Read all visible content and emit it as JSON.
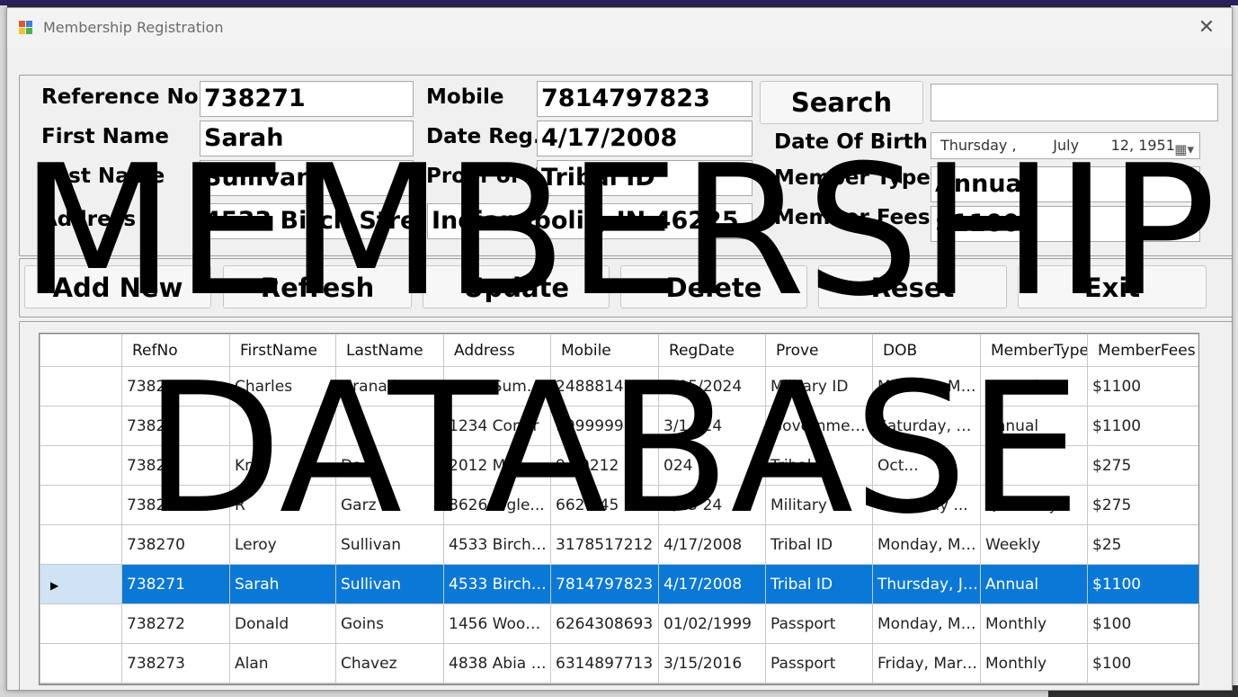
{
  "window": {
    "title": "Membership Registration",
    "close_glyph": "✕"
  },
  "form": {
    "reference_no": {
      "label": "Reference No:",
      "value": "738271"
    },
    "first_name": {
      "label": "First Name",
      "value": "Sarah"
    },
    "last_name": {
      "label": "Last Name",
      "value": "Sullivan"
    },
    "address": {
      "label": "Address",
      "value": "4533 Birch Street",
      "value2": "Indianapolis, IN 46225"
    },
    "mobile": {
      "label": "Mobile",
      "value": "7814797823"
    },
    "date_reg": {
      "label": "Date Reg.",
      "value": "4/17/2008"
    },
    "proof_of_id": {
      "label": "Proof of ID",
      "value": "Tribal ID"
    },
    "search": {
      "label": "Search",
      "value": ""
    },
    "date_of_birth": {
      "label": "Date Of Birth",
      "day": "Thursday",
      "month": "July",
      "date": "12, 1951"
    },
    "member_type": {
      "label": "Member Type",
      "value": "Annual"
    },
    "member_fees": {
      "label": "Member Fees",
      "value": "$1100"
    }
  },
  "buttons": {
    "add_new": "Add New",
    "refresh": "Refresh",
    "update": "Update",
    "delete": "Delete",
    "reset": "Reset",
    "exit": "Exit"
  },
  "grid": {
    "columns": [
      "RefNo",
      "FirstName",
      "LastName",
      "Address",
      "Mobile",
      "RegDate",
      "Prove",
      "DOB",
      "MemberType",
      "MemberFees"
    ],
    "selected_index": 5,
    "rows": [
      [
        "738255",
        "Charles",
        "Granados",
        "3959 Summit...",
        "2488814941",
        "2/25/2024",
        "Military ID",
        "Monday, Mar...",
        "Annual",
        "$1100"
      ],
      [
        "7382",
        "",
        "",
        "1234 Comfr",
        "9999999",
        "3/1  024",
        "Government ..",
        "Saturday, Ma...",
        "Annual",
        "$1100"
      ],
      [
        "7382",
        "Kri  a",
        "Da  s",
        "2012 Mor",
        "9  70212",
        "  024",
        "Tribal",
        "    Oct...",
        "",
        "$275"
      ],
      [
        "7382",
        "R",
        "Garz",
        "8626 T  gle...",
        "662  245",
        "3/15   24",
        "Military",
        "Thursday ...",
        "Quarterly",
        "$275"
      ],
      [
        "738270",
        "Leroy",
        "Sullivan",
        "4533 Birch S...",
        "3178517212",
        "4/17/2008",
        "Tribal ID",
        "Monday, Ma...",
        "Weekly",
        "$25"
      ],
      [
        "738271",
        "Sarah",
        "Sullivan",
        "4533 Birch S...",
        "7814797823",
        "4/17/2008",
        "Tribal ID",
        "Thursday, Jul...",
        "Annual",
        "$1100"
      ],
      [
        "738272",
        "Donald",
        "Goins",
        "1456 Woods...",
        "6264308693",
        "01/02/1999",
        "Passport",
        "Monday, Ma...",
        "Monthly",
        "$100"
      ],
      [
        "738273",
        "Alan",
        "Chavez",
        "4838 Abia M...",
        "6314897713",
        "3/15/2016",
        "Passport",
        "Friday, Marc...",
        "Monthly",
        "$100"
      ]
    ]
  },
  "overlay": {
    "line1": "MEMBERSHIP",
    "line2": "DATABASE"
  },
  "colors": {
    "selection": "#0a78d7",
    "row_header_selected": "#cfe3f4"
  }
}
